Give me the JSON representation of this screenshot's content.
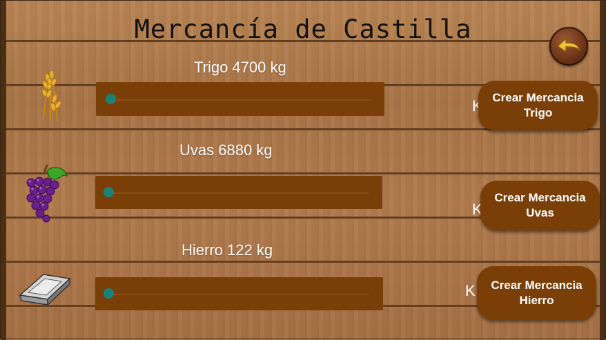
{
  "header": {
    "title": "Mercancía de Castilla"
  },
  "nav": {
    "back_icon": "back-arrow-icon"
  },
  "colors": {
    "bar": "#7a3f06",
    "thumb": "#16847a",
    "wood": "#b07a4c",
    "button": "#7a3f06",
    "text": "#ffffff"
  },
  "resources": [
    {
      "label": "Trigo 4700 kg",
      "icon": "wheat-icon",
      "slider_value": 0,
      "k_text": "K",
      "button_label": "Crear Mercancia\nTrigo"
    },
    {
      "label": "Uvas 6880 kg",
      "icon": "grapes-icon",
      "slider_value": 0,
      "k_text": "K",
      "button_label": "Crear Mercancia\nUvas"
    },
    {
      "label": "Hierro 122 kg",
      "icon": "iron-ingot-icon",
      "slider_value": 0,
      "k_text": "K",
      "button_label": "Crear Mercancia\nHierro"
    }
  ]
}
